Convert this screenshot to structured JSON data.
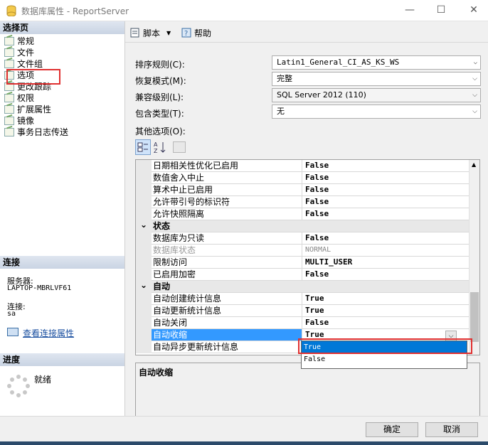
{
  "window": {
    "title": "数据库属性 - ReportServer",
    "minimize": "—",
    "maximize": "☐",
    "close": "✕"
  },
  "left": {
    "select_page_header": "选择页",
    "nav": [
      "常规",
      "文件",
      "文件组",
      "选项",
      "更改跟踪",
      "权限",
      "扩展属性",
      "镜像",
      "事务日志传送"
    ],
    "connection_header": "连接",
    "server_label": "服务器:",
    "server_value": "LAPTOP-MBRLVF61",
    "connection_label": "连接:",
    "connection_value": "sa",
    "view_conn_link": "查看连接属性",
    "progress_header": "进度",
    "progress_status": "就绪"
  },
  "toolbar": {
    "script": "脚本",
    "help": "帮助"
  },
  "form": {
    "collation_label": "排序规则(C):",
    "collation_value": "Latin1_General_CI_AS_KS_WS",
    "recovery_label": "恢复模式(M):",
    "recovery_value": "完整",
    "compat_label": "兼容级别(L):",
    "compat_value": "SQL Server 2012 (110)",
    "containment_label": "包含类型(T):",
    "containment_value": "无",
    "other_label": "其他选项(O):"
  },
  "grid_rows": [
    {
      "name": "日期相关性优化已启用",
      "value": "False"
    },
    {
      "name": "数值舍入中止",
      "value": "False"
    },
    {
      "name": "算术中止已启用",
      "value": "False"
    },
    {
      "name": "允许带引号的标识符",
      "value": "False"
    },
    {
      "name": "允许快照隔离",
      "value": "False"
    },
    {
      "name": "状态",
      "value": "",
      "category": true
    },
    {
      "name": "数据库为只读",
      "value": "False"
    },
    {
      "name": "数据库状态",
      "value": "NORMAL",
      "disabled": true
    },
    {
      "name": "限制访问",
      "value": "MULTI_USER"
    },
    {
      "name": "已启用加密",
      "value": "False"
    },
    {
      "name": "自动",
      "value": "",
      "category": true
    },
    {
      "name": "自动创建统计信息",
      "value": "True"
    },
    {
      "name": "自动更新统计信息",
      "value": "True"
    },
    {
      "name": "自动关闭",
      "value": "False"
    },
    {
      "name": "自动收缩",
      "value": "True",
      "selected": true
    },
    {
      "name": "自动异步更新统计信息",
      "value": ""
    }
  ],
  "dropdown_options": [
    "True",
    "False"
  ],
  "description": {
    "title": "自动收缩"
  },
  "buttons": {
    "ok": "确定",
    "cancel": "取消"
  }
}
